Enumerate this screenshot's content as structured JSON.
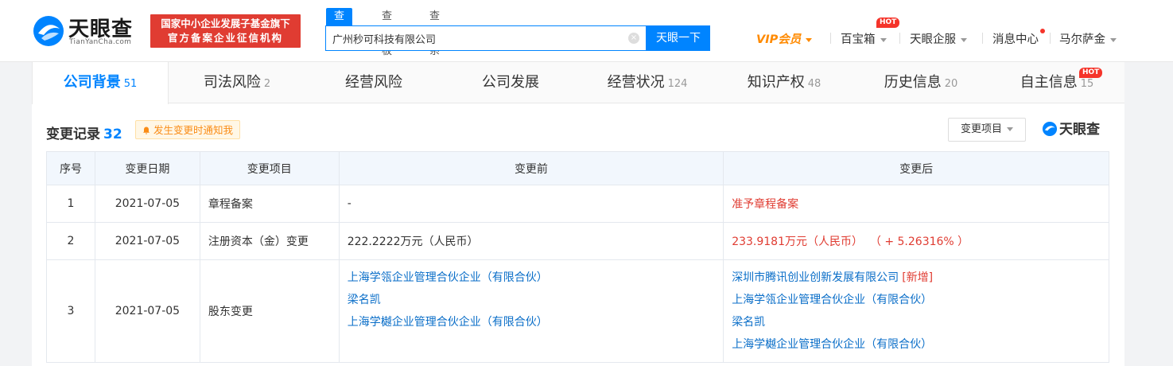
{
  "header": {
    "logo_name": "天眼查",
    "logo_sub": "TianYanCha.com",
    "slogan_line1": "国家中小企业发展子基金旗下",
    "slogan_line2": "官方备案企业征信机构",
    "search_tabs": [
      "查公司",
      "查老板",
      "查关系"
    ],
    "search_value": "广州秒可科技有限公司",
    "search_button": "天眼一下",
    "nav": {
      "vip": "VIP会员",
      "baobaoxiang": "百宝箱",
      "hot": "HOT",
      "qifu": "天眼企服",
      "messages": "消息中心",
      "user": "马尔萨金"
    }
  },
  "tabs": [
    {
      "label": "公司背景",
      "count": "51"
    },
    {
      "label": "司法风险",
      "count": "2"
    },
    {
      "label": "经营风险",
      "count": ""
    },
    {
      "label": "公司发展",
      "count": ""
    },
    {
      "label": "经营状况",
      "count": "124"
    },
    {
      "label": "知识产权",
      "count": "48"
    },
    {
      "label": "历史信息",
      "count": "20"
    },
    {
      "label": "自主信息",
      "count": "15"
    }
  ],
  "tab_hot": "HOT",
  "section": {
    "title": "变更记录",
    "count": "32",
    "notify": "发生变更时通知我",
    "filter": "变更项目",
    "brand": "天眼查"
  },
  "table": {
    "headers": [
      "序号",
      "变更日期",
      "变更项目",
      "变更前",
      "变更后"
    ],
    "rows": [
      {
        "no": "1",
        "date": "2021-07-05",
        "item": "章程备案",
        "before": "-",
        "after": "准予章程备案"
      },
      {
        "no": "2",
        "date": "2021-07-05",
        "item": "注册资本（金）变更",
        "before": "222.2222万元（人民币）",
        "after": "233.9181万元（人民币）  （ + 5.26316% ）"
      },
      {
        "no": "3",
        "date": "2021-07-05",
        "item": "股东变更",
        "before": [
          "上海学瓴企业管理合伙企业（有限合伙）",
          "梁名凯",
          "上海学樾企业管理合伙企业（有限合伙）"
        ],
        "after": [
          "深圳市腾讯创业创新发展有限公司",
          "上海学瓴企业管理合伙企业（有限合伙）",
          "梁名凯",
          "上海学樾企业管理合伙企业（有限合伙）"
        ],
        "after_new_tag": "[新增]"
      }
    ]
  },
  "colors": {
    "accent": "#0084ff",
    "link": "#0a6ec8",
    "red": "#e03c32",
    "vip": "#ff8a00"
  }
}
